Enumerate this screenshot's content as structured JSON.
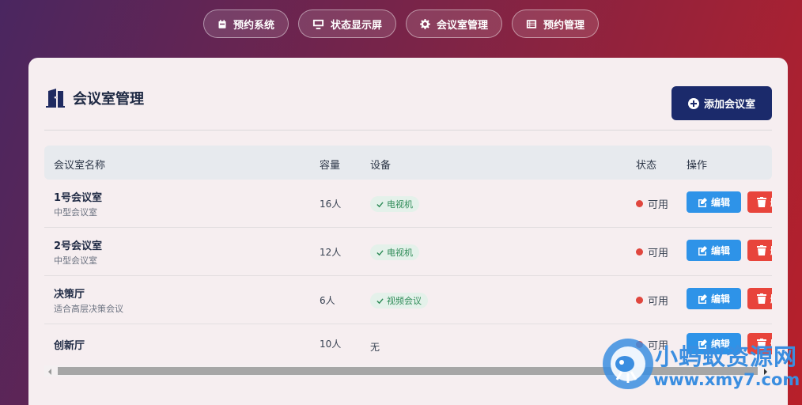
{
  "nav": [
    {
      "label": "预约系统",
      "icon": "calendar-icon"
    },
    {
      "label": "状态显示屏",
      "icon": "monitor-icon"
    },
    {
      "label": "会议室管理",
      "icon": "gear-icon"
    },
    {
      "label": "预约管理",
      "icon": "list-icon"
    }
  ],
  "card": {
    "title": "会议室管理",
    "title_icon": "door-icon",
    "add_label": "添加会议室"
  },
  "table": {
    "headers": [
      "会议室名称",
      "容量",
      "设备",
      "状态",
      "操作"
    ],
    "rows": [
      {
        "name": "1号会议室",
        "desc": "中型会议室",
        "capacity": "16人",
        "equipment": "电视机",
        "status": "可用",
        "edit": "编辑",
        "delete": "删除"
      },
      {
        "name": "2号会议室",
        "desc": "中型会议室",
        "capacity": "12人",
        "equipment": "电视机",
        "status": "可用",
        "edit": "编辑",
        "delete": "删除"
      },
      {
        "name": "决策厅",
        "desc": "适合高层决策会议",
        "capacity": "6人",
        "equipment": "视频会议",
        "status": "可用",
        "edit": "编辑",
        "delete": "删除"
      },
      {
        "name": "创新厅",
        "desc": "",
        "capacity": "10人",
        "equipment": "无",
        "status": "可用",
        "edit": "编辑",
        "delete": "删除"
      }
    ]
  },
  "colors": {
    "primary": "#1b2a6b",
    "edit": "#2e93e8",
    "delete": "#e8443b",
    "status_dot": "#e0463e",
    "tag_bg": "#e4f1ea",
    "tag_text": "#2e8b57"
  },
  "watermark": {
    "line1": "小蚂蚁资源网",
    "line2": "www.xmy7.com"
  }
}
